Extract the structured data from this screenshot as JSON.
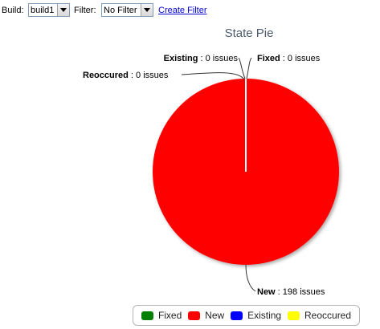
{
  "toolbar": {
    "build_label": "Build:",
    "build_value": "build1",
    "filter_label": "Filter:",
    "filter_value": "No Filter",
    "create_filter_link": "Create Filter"
  },
  "chart_data": {
    "type": "pie",
    "title": "State Pie",
    "slices": [
      {
        "name": "Fixed",
        "value": 0,
        "label_suffix": " : 0 issues",
        "color": "#008000"
      },
      {
        "name": "New",
        "value": 198,
        "label_suffix": " : 198 issues",
        "color": "#ff0000"
      },
      {
        "name": "Existing",
        "value": 0,
        "label_suffix": " : 0 issues",
        "color": "#0000ff"
      },
      {
        "name": "Reoccured",
        "value": 0,
        "label_suffix": " : 0 issues",
        "color": "#ffff00"
      }
    ],
    "legend_position": "bottom-right"
  },
  "legend": [
    {
      "name": "Fixed",
      "color": "#008000"
    },
    {
      "name": "New",
      "color": "#ff0000"
    },
    {
      "name": "Existing",
      "color": "#0000ff"
    },
    {
      "name": "Reoccured",
      "color": "#ffff00"
    }
  ]
}
